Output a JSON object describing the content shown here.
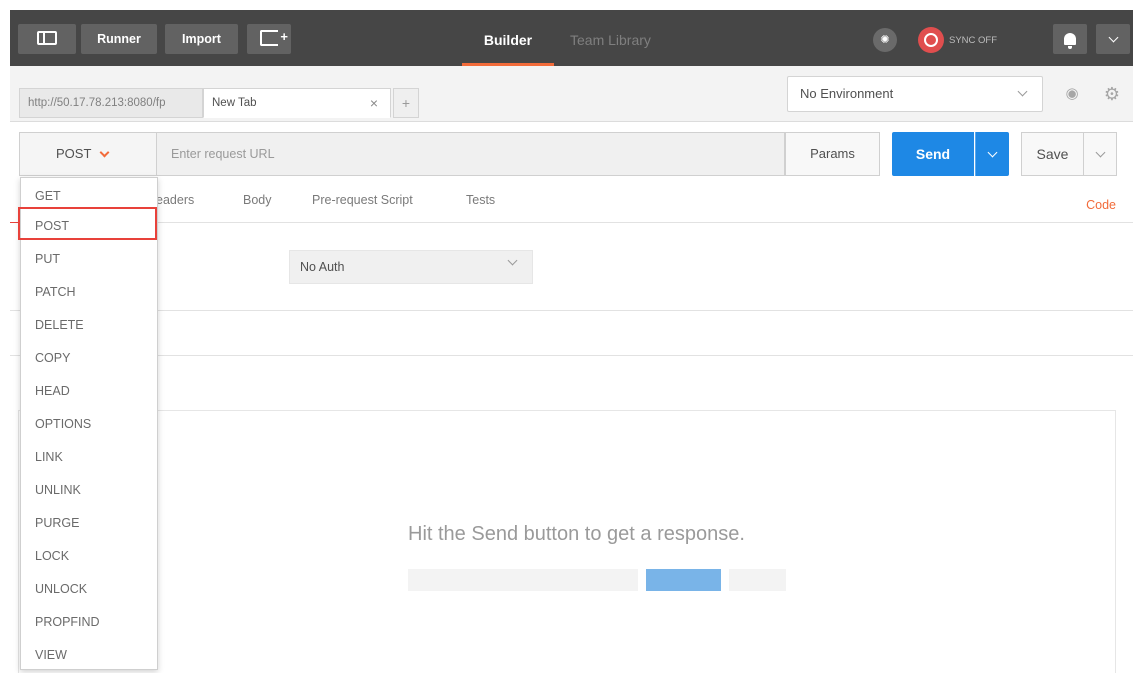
{
  "toolbar": {
    "runner": "Runner",
    "import": "Import",
    "builder": "Builder",
    "team_library": "Team Library",
    "sync_status": "SYNC OFF"
  },
  "tabs": {
    "tab1": "http://50.17.78.213:8080/fp",
    "tab2": "New Tab",
    "close_glyph": "×",
    "add_glyph": "+"
  },
  "environment": {
    "selected": "No Environment"
  },
  "request": {
    "method": "POST",
    "url_placeholder": "Enter request URL",
    "params": "Params",
    "send": "Send",
    "save": "Save"
  },
  "subtabs": {
    "headers": "Headers",
    "body": "Body",
    "prerequest": "Pre-request Script",
    "tests": "Tests",
    "code": "Code"
  },
  "auth": {
    "selected": "No Auth"
  },
  "response": {
    "hint": "Hit the Send button to get a response."
  },
  "methods": [
    "GET",
    "POST",
    "PUT",
    "PATCH",
    "DELETE",
    "COPY",
    "HEAD",
    "OPTIONS",
    "LINK",
    "UNLINK",
    "PURGE",
    "LOCK",
    "UNLOCK",
    "PROPFIND",
    "VIEW"
  ],
  "colors": {
    "accent": "#f26b3a",
    "send_blue": "#1e88e5",
    "highlight_red": "#e8413a",
    "topbar": "#464646"
  }
}
